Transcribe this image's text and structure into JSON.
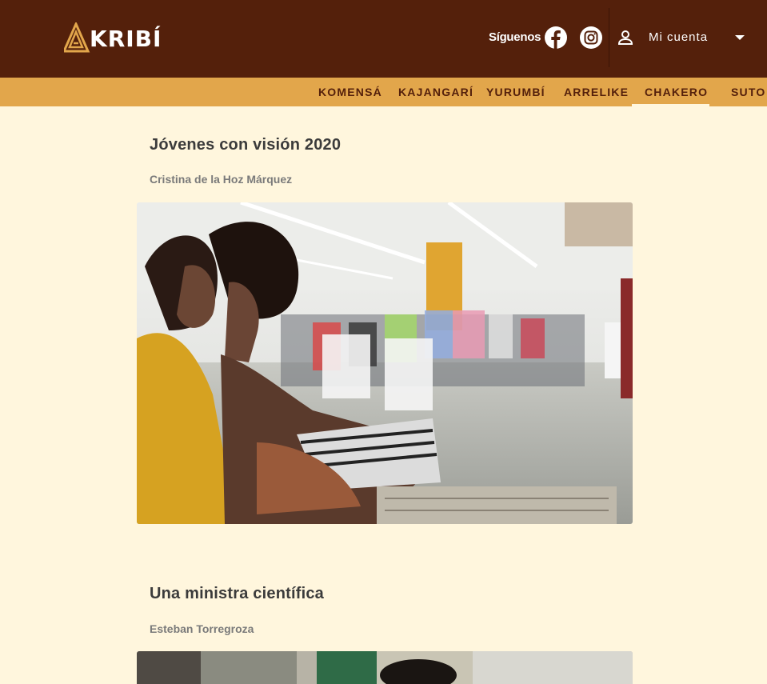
{
  "header": {
    "logo_text": "KRIBÍ",
    "follow_label": "Síguenos",
    "social": [
      {
        "name": "facebook",
        "icon": "facebook-icon"
      },
      {
        "name": "instagram",
        "icon": "instagram-icon"
      }
    ],
    "account": {
      "label": "Mi cuenta",
      "icon": "person-icon",
      "caret": "caret-down-icon"
    }
  },
  "nav": {
    "items": [
      {
        "label": "KOMENSÁ",
        "active": false
      },
      {
        "label": "KAJANGARÍ",
        "active": false
      },
      {
        "label": "YURUMBÍ",
        "active": false
      },
      {
        "label": "ARRELIKE",
        "active": false
      },
      {
        "label": "CHAKERO",
        "active": true
      },
      {
        "label": "SUTO",
        "active": false
      }
    ]
  },
  "articles": [
    {
      "title": "Jóvenes con visión 2020",
      "author": "Cristina de la Hoz Márquez"
    },
    {
      "title": "Una ministra científica",
      "author": "Esteban Torregroza"
    }
  ],
  "colors": {
    "header_bg": "#54200b",
    "nav_bg": "#e2a64b",
    "page_bg": "#fff6dd",
    "logo_accent": "#e2a64b"
  }
}
